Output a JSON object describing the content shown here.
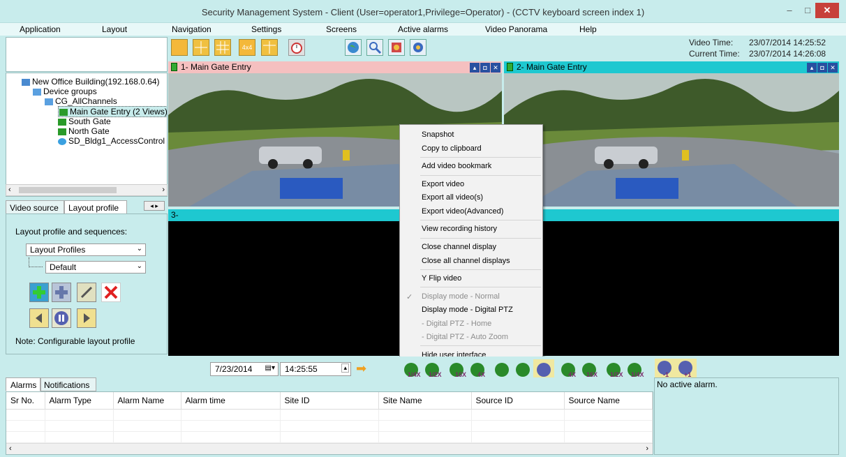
{
  "window": {
    "title": "Security Management System - Client (User=operator1,Privilege=Operator) - (CCTV keyboard screen index 1)",
    "minimize": "–",
    "maximize": "□",
    "close": "✕"
  },
  "menu": [
    "Application",
    "Layout",
    "Navigation",
    "Settings",
    "Screens",
    "Active alarms",
    "Video Panorama",
    "Help"
  ],
  "time": {
    "video_label": "Video Time:",
    "video_value": "23/07/2014 14:25:52",
    "current_label": "Current Time:",
    "current_value": "23/07/2014 14:26:08"
  },
  "toolbar": {
    "layout_4x4": "4x4"
  },
  "tree": {
    "root": "New Office Building(192.168.0.64)",
    "groups": "Device groups",
    "channel_group": "CG_AllChannels",
    "items": [
      "Main Gate Entry (2 Views)",
      "South Gate",
      "North Gate",
      "SD_Bldg1_AccessControl"
    ]
  },
  "left_tabs": [
    "Video source",
    "Layout profile"
  ],
  "layout_panel": {
    "heading": "Layout profile and sequences:",
    "profiles_select": "Layout Profiles",
    "default_select": "Default",
    "note": "Note: Configurable layout profile"
  },
  "videos": [
    {
      "title": "1- Main Gate Entry"
    },
    {
      "title": "2- Main Gate Entry"
    },
    {
      "title": "3-"
    }
  ],
  "context_menu": {
    "items": [
      {
        "label": "Snapshot",
        "enabled": true
      },
      {
        "label": "Copy to clipboard",
        "enabled": true
      },
      {
        "label": "Add video bookmark",
        "enabled": true
      },
      {
        "label": "Export video",
        "enabled": true
      },
      {
        "label": "Export all video(s)",
        "enabled": true
      },
      {
        "label": "Export video(Advanced)",
        "enabled": true
      },
      {
        "label": "View recording history",
        "enabled": true
      },
      {
        "label": "Close channel display",
        "enabled": true
      },
      {
        "label": "Close all channel displays",
        "enabled": true
      },
      {
        "label": "Y Flip video",
        "enabled": true
      },
      {
        "label": "Display mode - Normal",
        "enabled": false,
        "checked": true
      },
      {
        "label": "Display mode - Digital PTZ",
        "enabled": true
      },
      {
        "label": "- Digital PTZ - Home",
        "enabled": false
      },
      {
        "label": "- Digital PTZ - Auto Zoom",
        "enabled": false
      },
      {
        "label": "Hide user interface",
        "enabled": true
      }
    ]
  },
  "playback": {
    "date": "7/23/2014",
    "time": "14:25:55",
    "speed_labels": [
      "1/4X",
      "1/2X",
      "16X",
      "4X",
      "4X",
      "16X",
      "1/2X",
      "1/4X",
      "-1",
      "+1"
    ]
  },
  "bottom_tabs": [
    "Alarms",
    "Notifications"
  ],
  "alarm_table": {
    "columns": [
      "Sr No.",
      "Alarm Type",
      "Alarm Name",
      "Alarm time",
      "Site ID",
      "Site Name",
      "Source ID",
      "Source Name"
    ]
  },
  "alarm_status": "No active alarm.",
  "colors": {
    "background": "#c8ecec",
    "video1_header": "#f5c0c0",
    "video_header": "#1ec8d0",
    "close": "#c7403a"
  }
}
